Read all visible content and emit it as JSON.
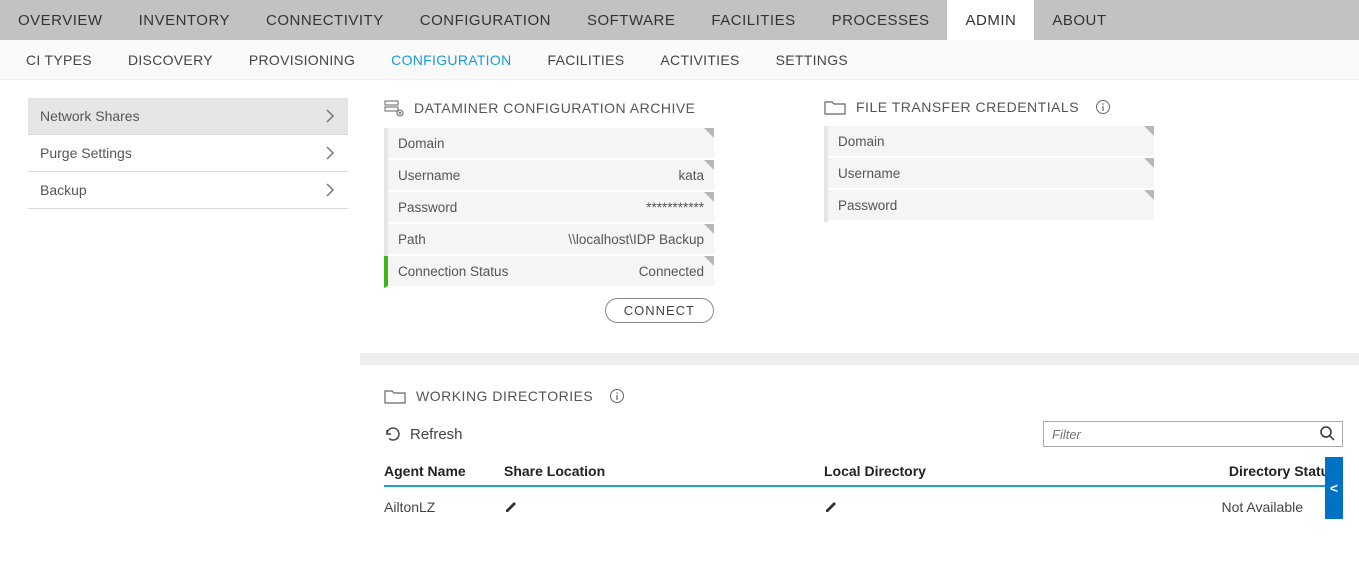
{
  "topTabs": {
    "items": [
      "OVERVIEW",
      "INVENTORY",
      "CONNECTIVITY",
      "CONFIGURATION",
      "SOFTWARE",
      "FACILITIES",
      "PROCESSES",
      "ADMIN",
      "ABOUT"
    ],
    "activeIndex": 7
  },
  "subTabs": {
    "items": [
      "CI TYPES",
      "DISCOVERY",
      "PROVISIONING",
      "CONFIGURATION",
      "FACILITIES",
      "ACTIVITIES",
      "SETTINGS"
    ],
    "activeIndex": 3
  },
  "sidebar": {
    "items": [
      "Network Shares",
      "Purge Settings",
      "Backup"
    ],
    "selectedIndex": 0
  },
  "archivePanel": {
    "title": "DATAMINER CONFIGURATION ARCHIVE",
    "rows": {
      "domainLabel": "Domain",
      "domainValue": "",
      "usernameLabel": "Username",
      "usernameValue": "kata",
      "passwordLabel": "Password",
      "passwordValue": "***********",
      "pathLabel": "Path",
      "pathValue": "\\\\localhost\\IDP Backup",
      "statusLabel": "Connection Status",
      "statusValue": "Connected"
    },
    "connectLabel": "CONNECT"
  },
  "credentialsPanel": {
    "title": "FILE TRANSFER CREDENTIALS",
    "rows": {
      "domainLabel": "Domain",
      "domainValue": "",
      "usernameLabel": "Username",
      "usernameValue": "",
      "passwordLabel": "Password",
      "passwordValue": ""
    }
  },
  "workingDirs": {
    "title": "WORKING DIRECTORIES",
    "refreshLabel": "Refresh",
    "filterPlaceholder": "Filter",
    "columns": {
      "agent": "Agent Name",
      "share": "Share Location",
      "local": "Local Directory",
      "status": "Directory Status"
    },
    "row": {
      "agent": "AiltonLZ",
      "status": "Not Available"
    },
    "handleGlyph": "<"
  }
}
